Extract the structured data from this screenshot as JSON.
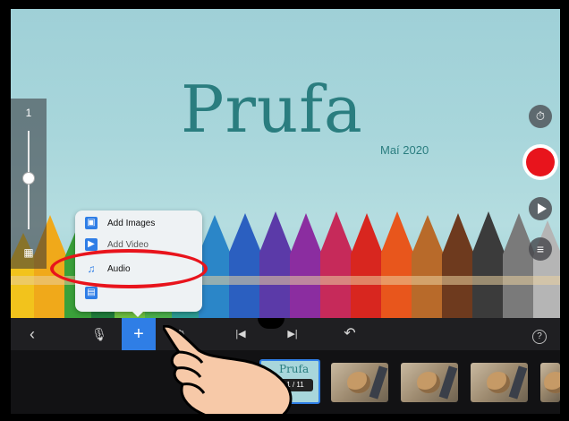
{
  "slide": {
    "title": "Prufa",
    "subtitle": "Maí 2020"
  },
  "popup_menu": {
    "items": [
      {
        "label": "Add Images",
        "icon": "image-icon"
      },
      {
        "label": "Add Video",
        "icon": "video-icon"
      },
      {
        "label": "Audio",
        "icon": "music-note-icon"
      },
      {
        "label": "",
        "icon": "file-icon"
      }
    ]
  },
  "toolbar": {
    "back_icon": "‹",
    "mic_icon": "🎙",
    "add_icon": "+",
    "speed_icon": "⏱",
    "prev_icon": "|◀",
    "next_icon": "▶|",
    "undo_icon": "↶",
    "help_icon": "?"
  },
  "filmstrip": {
    "selected_badge": "1 / 11",
    "selected_title": "Prufa"
  },
  "left_panel": {
    "top_icon": "1",
    "bottom_icon": "▦"
  },
  "colors": {
    "accent": "#2f7ee6",
    "record": "#e8141c",
    "title": "#2a7d7f",
    "annotation": "#e8141c"
  }
}
